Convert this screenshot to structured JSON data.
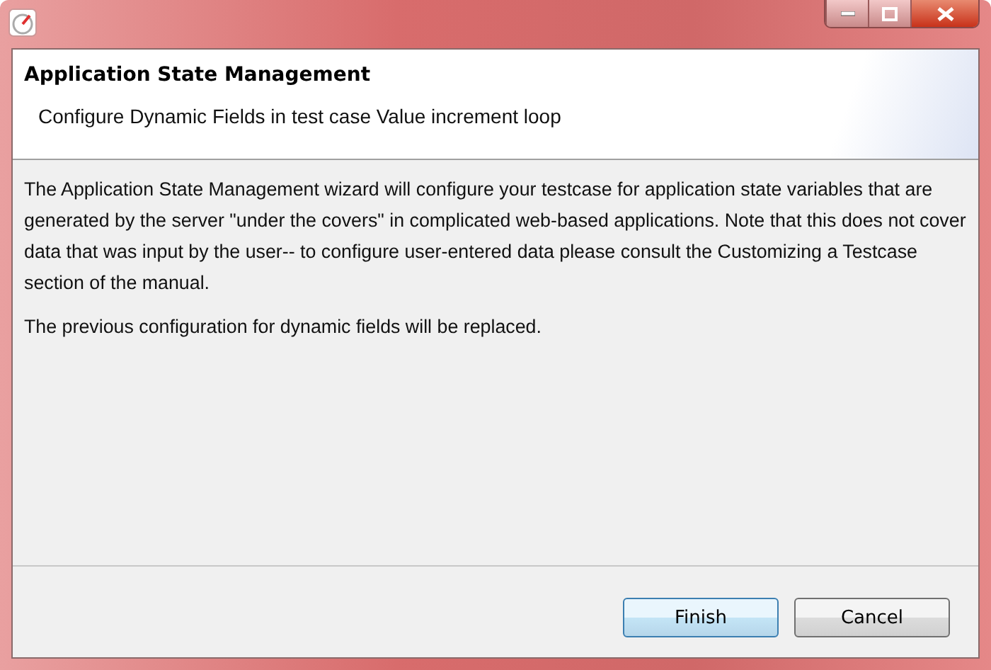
{
  "header": {
    "title": "Application State Management",
    "subtitle": "Configure Dynamic Fields in test case Value increment loop"
  },
  "body": [
    "The Application State Management wizard will configure your testcase for application state variables that are generated by the server \"under the covers\" in complicated web-based applications. Note that this does not cover data that was input by the user-- to configure user-entered data please consult the Customizing a Testcase section of the manual.",
    "The previous configuration for dynamic fields will be replaced."
  ],
  "buttons": [
    {
      "label": "Finish",
      "default": true
    },
    {
      "label": "Cancel",
      "default": false
    }
  ]
}
